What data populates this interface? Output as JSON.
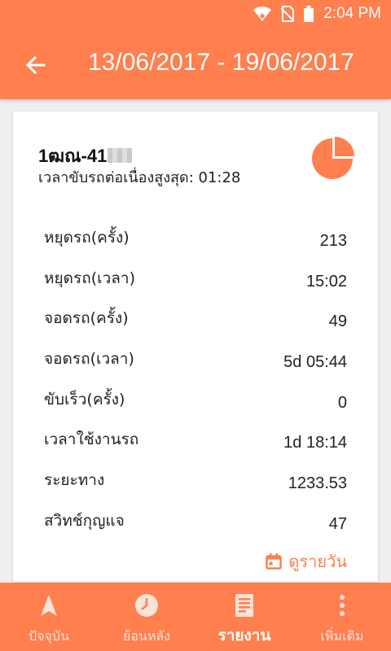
{
  "status_bar": {
    "time": "2:04 PM",
    "icons": [
      "wifi-icon",
      "no-sim-icon",
      "battery-icon"
    ]
  },
  "app_bar": {
    "title": "13/06/2017 - 19/06/2017",
    "back_icon": "arrow-left-icon"
  },
  "card": {
    "plate": "1ฒณ-41",
    "max_continuous_drive": "เวลาขับรถต่อเนื่องสูงสุด: 01:28",
    "pie_icon": "pie-chart-icon",
    "stats": [
      {
        "label": "หยุดรถ(ครั้ง)",
        "value": "213"
      },
      {
        "label": "หยุดรถ(เวลา)",
        "value": "15:02"
      },
      {
        "label": "จอดรถ(ครั้ง)",
        "value": "49"
      },
      {
        "label": "จอดรถ(เวลา)",
        "value": "5d 05:44"
      },
      {
        "label": "ขับเร็ว(ครั้ง)",
        "value": "0"
      },
      {
        "label": "เวลาใช้งานรถ",
        "value": "1d 18:14"
      },
      {
        "label": "ระยะทาง",
        "value": "1233.53"
      },
      {
        "label": "สวิทช์กุญแจ",
        "value": "47"
      }
    ],
    "daily_link": "ดูรายวัน",
    "daily_icon": "calendar-icon"
  },
  "bottom_nav": [
    {
      "label": "ปัจจุบัน",
      "icon": "navigation-arrow-icon",
      "active": false
    },
    {
      "label": "ย้อนหลัง",
      "icon": "clock-icon",
      "active": false
    },
    {
      "label": "รายงาน",
      "icon": "report-icon",
      "active": true
    },
    {
      "label": "เพิ่มเติม",
      "icon": "more-vertical-icon",
      "active": false
    }
  ],
  "colors": {
    "accent": "#ff7f4f",
    "card_bg": "#ffffff",
    "page_bg": "#efefef"
  }
}
